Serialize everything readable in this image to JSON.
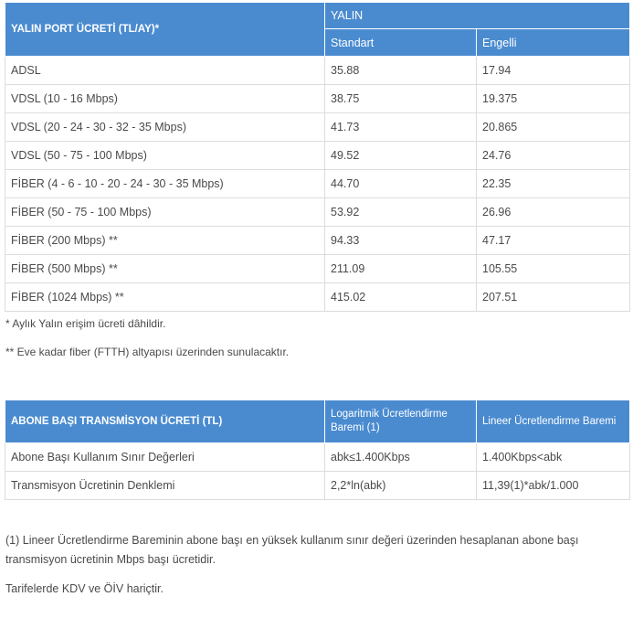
{
  "table1": {
    "header_main": "YALIN PORT ÜCRETİ (TL/AY)*",
    "header_group": "YALIN",
    "header_standard": "Standart",
    "header_disabled": "Engelli",
    "rows": [
      {
        "name": "ADSL",
        "standard": "35.88",
        "disabled": "17.94"
      },
      {
        "name": "VDSL (10 - 16 Mbps)",
        "standard": "38.75",
        "disabled": "19.375"
      },
      {
        "name": "VDSL (20 - 24 - 30 - 32 - 35 Mbps)",
        "standard": "41.73",
        "disabled": "20.865"
      },
      {
        "name": "VDSL (50 - 75 - 100 Mbps)",
        "standard": "49.52",
        "disabled": "24.76"
      },
      {
        "name": "FİBER (4 - 6 - 10 - 20 - 24 - 30 - 35 Mbps)",
        "standard": "44.70",
        "disabled": "22.35"
      },
      {
        "name": "FİBER (50 - 75 - 100 Mbps)",
        "standard": "53.92",
        "disabled": "26.96"
      },
      {
        "name": "FİBER (200 Mbps) **",
        "standard": "94.33",
        "disabled": "47.17"
      },
      {
        "name": "FİBER (500 Mbps) **",
        "standard": "211.09",
        "disabled": "105.55"
      },
      {
        "name": "FİBER (1024 Mbps) **",
        "standard": "415.02",
        "disabled": "207.51"
      }
    ]
  },
  "notes": {
    "note1": "* Aylık Yalın erişim ücreti dâhildir.",
    "note2": "** Eve kadar fiber (FTTH) altyapısı üzerinden sunulacaktır."
  },
  "table2": {
    "header_main": "ABONE BAŞI TRANSMİSYON ÜCRETİ (TL)",
    "header_log": "Logaritmik Ücretlendirme Baremi (1)",
    "header_linear": "Lineer Ücretlendirme Baremi",
    "rows": [
      {
        "name": "Abone Başı Kullanım Sınır Değerleri",
        "log": "abk≤1.400Kbps",
        "linear": "1.400Kbps<abk"
      },
      {
        "name": "Transmisyon Ücretinin Denklemi",
        "log": "2,2*ln(abk)",
        "linear": "11,39(1)*abk/1.000"
      }
    ]
  },
  "footer": {
    "para1": "(1) Lineer Ücretlendirme Bareminin abone başı en yüksek kullanım sınır değeri üzerinden hesaplanan abone başı transmisyon ücretinin Mbps başı ücretidir.",
    "para2": "Tarifelerde KDV ve ÖİV hariçtir."
  }
}
